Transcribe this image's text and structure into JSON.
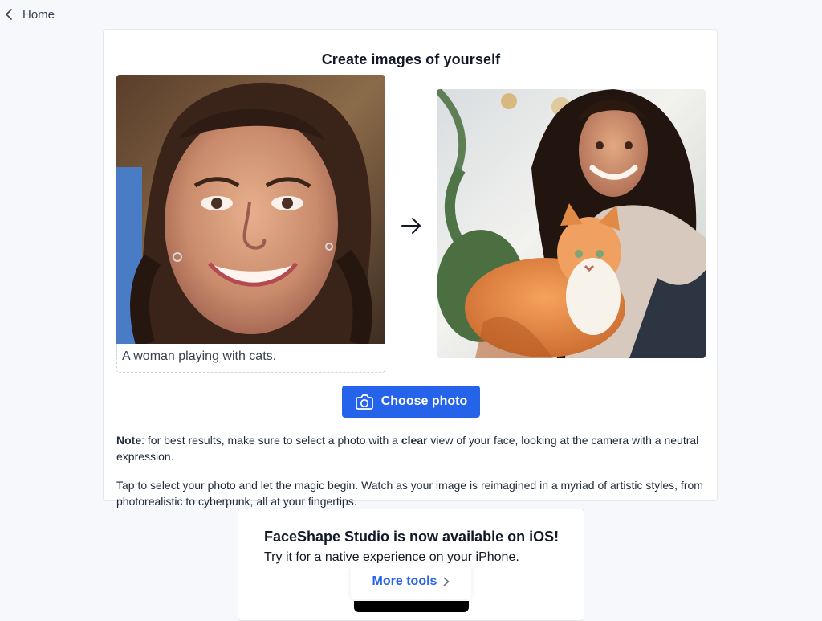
{
  "nav": {
    "back_label": "Home",
    "back_icon": "chevron-left-icon"
  },
  "main": {
    "title": "Create images of yourself",
    "prompt": "A woman playing with cats.",
    "source_image": "woman-portrait",
    "result_image": "woman-with-cat",
    "arrow_icon": "arrow-right-icon",
    "choose_button": {
      "label": "Choose photo",
      "icon": "camera-icon"
    },
    "note": {
      "prefix": "Note",
      "text_before_bold": ": for best results, make sure to select a photo with a ",
      "bold": "clear",
      "text_after_bold": " view of your face, looking at the camera with a neutral expression."
    },
    "intro": "Tap to select your photo and let the magic begin. Watch as your image is reimagined in a myriad of artistic styles, from photorealistic to cyberpunk, all at your fingertips."
  },
  "ios": {
    "title": "FaceShape Studio is now available on iOS!",
    "subtitle": "Try it for a native experience on your iPhone."
  },
  "more_tools": {
    "label": "More tools",
    "icon": "chevron-right-icon"
  },
  "colors": {
    "accent": "#2563eb",
    "background": "#f7f8fb",
    "card": "#ffffff",
    "border": "#e5e7eb"
  }
}
